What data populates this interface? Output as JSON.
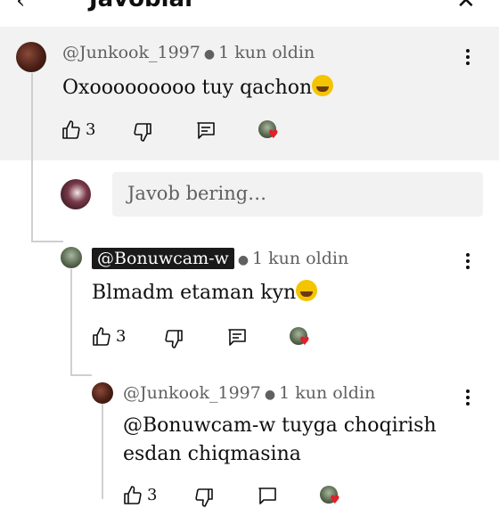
{
  "header": {
    "back_icon": "arrow-left-icon",
    "title": "Javoblar",
    "close_icon": "close-icon"
  },
  "top_comment": {
    "author": "@Junkook_1997",
    "time": "1 kun oldin",
    "text": "Oxooooooooo tuy qachon",
    "emoji": "rolling-on-floor-laughing",
    "likes": "3"
  },
  "reply_box": {
    "placeholder": "Javob bering…"
  },
  "replies": [
    {
      "author": "@Bonuwcam-w",
      "time": "1 kun oldin",
      "text": "Blmadm etaman kyn",
      "emoji": "face-with-tears-of-joy",
      "likes": "3"
    },
    {
      "author": "@Junkook_1997",
      "time": "1 kun oldin",
      "text_line1": "@Bonuwcam-w tuyga choqirish",
      "text_line2": "esdan chiqmasina",
      "likes": "3"
    }
  ],
  "colors": {
    "background": "#ffffff",
    "highlight": "#f2f2f2",
    "heart": "#e0202c",
    "secondary_text": "#606060"
  }
}
